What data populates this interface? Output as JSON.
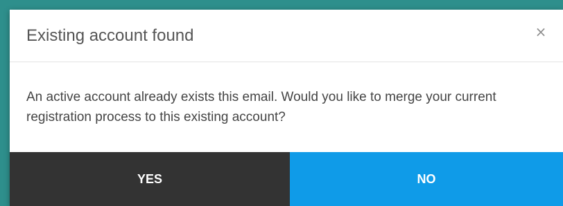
{
  "dialog": {
    "title": "Existing account found",
    "close_symbol": "×",
    "message": "An active account already exists this email. Would you like to merge your current registration process to this existing account?",
    "yes_label": "YES",
    "no_label": "NO"
  },
  "colors": {
    "background": "#2e8f8c",
    "modal": "#ffffff",
    "yes_button": "#333333",
    "no_button": "#0f9be8"
  },
  "icons": {
    "close": "close-icon"
  }
}
